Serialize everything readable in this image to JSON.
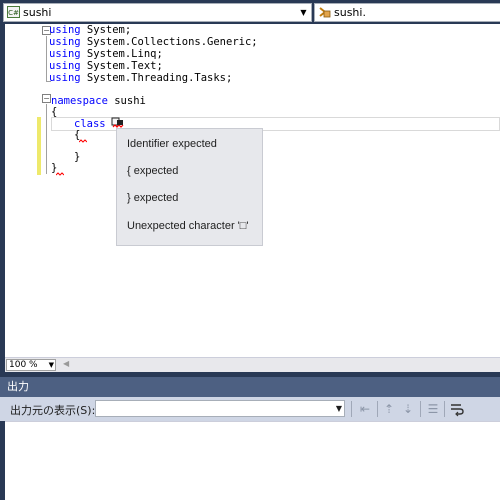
{
  "navbar": {
    "type_combo": {
      "label": "sushi",
      "icon": "csharp-project-icon"
    },
    "member_combo": {
      "label": "sushi.",
      "icon": "class-member-icon"
    }
  },
  "editor": {
    "lines": {
      "l1_kw": "using",
      "l1_rest": " System;",
      "l2_kw": "using",
      "l2_rest": " System.Collections.Generic;",
      "l3_kw": "using",
      "l3_rest": " System.Linq;",
      "l4_kw": "using",
      "l4_rest": " System.Text;",
      "l5_kw": "using",
      "l5_rest": " System.Threading.Tasks;",
      "l7_kw": "namespace",
      "l7_rest": " sushi",
      "l8": "{",
      "l9_kw": "class",
      "l10": "{",
      "l12": "}",
      "l13": "}"
    },
    "error_tooltip": {
      "messages": [
        "Identifier expected",
        "{ expected",
        "} expected",
        "Unexpected character '□'"
      ]
    },
    "colors": {
      "keyword": "#0000ff",
      "error_squiggle": "#ff0000",
      "changed_line": "#eee96b"
    }
  },
  "statusbar": {
    "zoom": "100 %"
  },
  "output_panel": {
    "title": "出力",
    "source_label": "出力元の表示(S):",
    "source_value": ""
  }
}
